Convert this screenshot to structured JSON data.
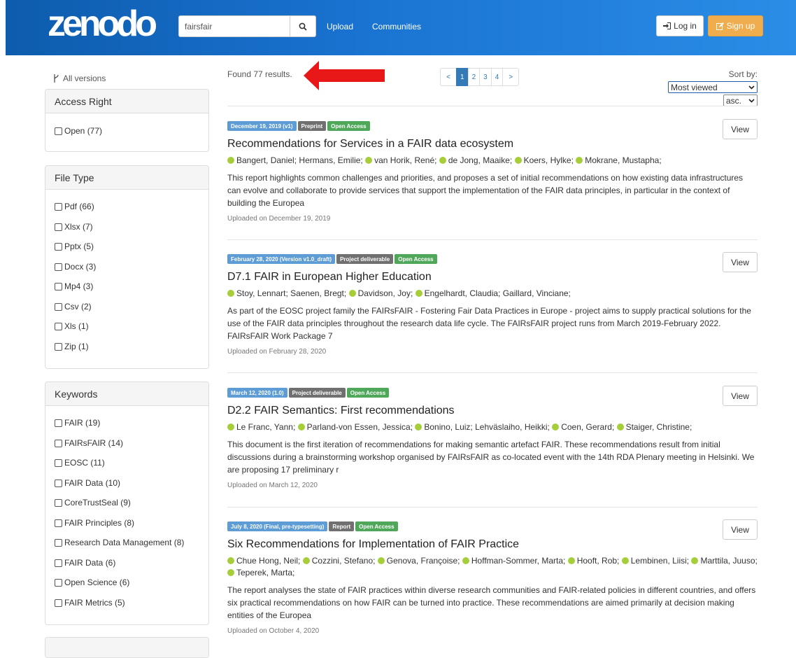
{
  "header": {
    "search_value": "fairsfair",
    "nav": [
      "Upload",
      "Communities"
    ],
    "login_label": "Log in",
    "signup_label": "Sign up",
    "signup_color": "#f0ad4e"
  },
  "sidebar": {
    "all_versions": "All versions",
    "facets": [
      {
        "title": "Access Right",
        "items": [
          "Open (77)"
        ]
      },
      {
        "title": "File Type",
        "items": [
          "Pdf (66)",
          "Xlsx (7)",
          "Pptx (5)",
          "Docx (3)",
          "Mp4 (3)",
          "Csv (2)",
          "Xls (1)",
          "Zip (1)"
        ]
      },
      {
        "title": "Keywords",
        "items": [
          "FAIR (19)",
          "FAIRsFAIR (14)",
          "EOSC (11)",
          "FAIR Data (10)",
          "CoreTrustSeal (9)",
          "FAIR Principles (8)",
          "Research Data Management (8)",
          "FAIR Data (6)",
          "Open Science (6)",
          "FAIR Metrics (5)"
        ]
      }
    ]
  },
  "results": {
    "found": "Found 77 results.",
    "pagination": [
      "<",
      "1",
      "2",
      "3",
      "4",
      ">"
    ],
    "sort_by_label": "Sort by:",
    "sort_value": "Most viewed",
    "order_value": "asc.",
    "view_label": "View",
    "records": [
      {
        "date_badge": "December 19, 2019 (v1)",
        "type_badge": "Preprint",
        "access_badge": "Open Access",
        "title": "Recommendations for Services in a FAIR data ecosystem",
        "authors": [
          {
            "name": "Bangert, Daniel;",
            "orcid": true
          },
          {
            "name": "Hermans, Emilie;",
            "orcid": false
          },
          {
            "name": "van Horik, René;",
            "orcid": true
          },
          {
            "name": "de Jong, Maaike;",
            "orcid": true
          },
          {
            "name": "Koers, Hylke;",
            "orcid": true
          },
          {
            "name": "Mokrane, Mustapha;",
            "orcid": true
          }
        ],
        "description": "This report highlights common challenges and priorities, and proposes a set of initial recommendations on how existing data infrastructures can evolve and collaborate to provide services that support the implementation of the FAIR data principles, in particular in the context of building the Europea",
        "uploaded": "Uploaded on December 19, 2019"
      },
      {
        "date_badge": "February 28, 2020 (Version v1.0_draft)",
        "type_badge": "Project deliverable",
        "access_badge": "Open Access",
        "title": "D7.1 FAIR in European Higher Education",
        "authors": [
          {
            "name": "Stoy, Lennart;",
            "orcid": true
          },
          {
            "name": "Saenen, Bregt;",
            "orcid": false
          },
          {
            "name": "Davidson, Joy;",
            "orcid": true
          },
          {
            "name": "Engelhardt, Claudia;",
            "orcid": true
          },
          {
            "name": "Gaillard, Vinciane;",
            "orcid": false
          }
        ],
        "description": "As part of the EOSC project family the FAIRsFAIR - Fostering Fair Data Practices in Europe - project aims to supply practical solutions for the use of the FAIR data principles throughout the research data life cycle. The FAIRsFAIR project runs from March 2019-February 2022. FAIRsFAIR Work Package 7",
        "uploaded": "Uploaded on February 28, 2020"
      },
      {
        "date_badge": "March 12, 2020 (1.0)",
        "type_badge": "Project deliverable",
        "access_badge": "Open Access",
        "title": "D2.2 FAIR Semantics: First recommendations",
        "authors": [
          {
            "name": "Le Franc, Yann;",
            "orcid": true
          },
          {
            "name": "Parland-von Essen, Jessica;",
            "orcid": true
          },
          {
            "name": "Bonino, Luiz;",
            "orcid": true
          },
          {
            "name": "Lehväslaiho, Heikki;",
            "orcid": false
          },
          {
            "name": "Coen, Gerard;",
            "orcid": true
          },
          {
            "name": "Staiger, Christine;",
            "orcid": true
          }
        ],
        "description": "This document is the first iteration of recommendations for making semantic artefact FAIR. These recommendations result from initial discussions during a brainstorming workshop organised by FAIRsFAIR as co-located event with the 14th RDA Plenary meeting in Helsinki. We are proposing 17 preliminary r",
        "uploaded": "Uploaded on March 12, 2020"
      },
      {
        "date_badge": "July 8, 2020 (Final, pre-typesetting)",
        "type_badge": "Report",
        "access_badge": "Open Access",
        "title": "Six Recommendations for Implementation of FAIR Practice",
        "authors": [
          {
            "name": "Chue Hong, Neil;",
            "orcid": true
          },
          {
            "name": "Cozzini, Stefano;",
            "orcid": true
          },
          {
            "name": "Genova, Françoise;",
            "orcid": true
          },
          {
            "name": "Hoffman-Sommer, Marta;",
            "orcid": true
          },
          {
            "name": "Hooft, Rob;",
            "orcid": true
          },
          {
            "name": "Lembinen, Liisi;",
            "orcid": true
          },
          {
            "name": "Marttila, Juuso;",
            "orcid": true
          },
          {
            "name": "Teperek, Marta;",
            "orcid": true
          }
        ],
        "description": "The report analyses the state of FAIR practices within diverse research communities and FAIR-related policies in different countries, and offers six practical recommendations on how FAIR can be turned into practice. These recommendations are aimed primarily at decision making entities of the Europea",
        "uploaded": "Uploaded on October 4, 2020"
      }
    ]
  }
}
